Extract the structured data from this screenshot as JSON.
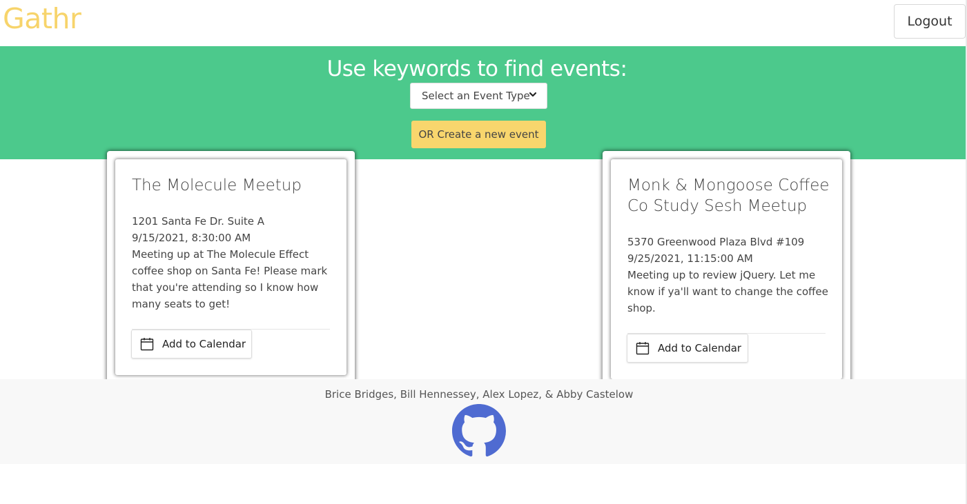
{
  "navbar": {
    "brand": "Gathr",
    "logout_label": "Logout"
  },
  "hero": {
    "title": "Use keywords to find events:",
    "select_value": "Select an Event Type",
    "create_label": "OR Create a new event"
  },
  "events": [
    {
      "title_line1": "The Molecule Meetup",
      "address": "1201 Santa Fe Dr. Suite A",
      "datetime": "9/15/2021, 8:30:00 AM",
      "desc_lines": [
        "Meeting up at The Molecule Effect",
        "coffee shop on Santa Fe! Please mark",
        "that you're attending so I know how",
        "many seats to get!"
      ],
      "calendar_label": "Add to Calendar"
    },
    {
      "title_line1": "Monk & Mongoose Coffee",
      "title_line2": "Co Study Sesh Meetup",
      "address": "5370 Greenwood Plaza Blvd #109",
      "datetime": "9/25/2021, 11:15:00 AM",
      "desc_lines": [
        "Meeting up to review jQuery. Let me",
        "know if ya'll want to change the coffee",
        "shop."
      ],
      "calendar_label": "Add to Calendar"
    }
  ],
  "footer": {
    "names": "Brice Bridges, Bill Hennessey, Alex Lopez, & Abby Castelow",
    "github_icon": "github-icon"
  },
  "colors": {
    "brand": "#f7d46b",
    "hero_bg": "#4cc98c",
    "create_bg": "#f8d66d",
    "github": "#4f6bd1"
  }
}
